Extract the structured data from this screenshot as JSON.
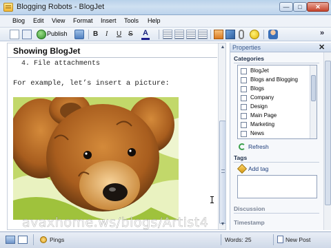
{
  "window": {
    "title": "Blogging Robots - BlogJet",
    "minimize": "—",
    "maximize": "□",
    "close": "✕"
  },
  "menu": [
    "Blog",
    "Edit",
    "View",
    "Format",
    "Insert",
    "Tools",
    "Help"
  ],
  "toolbar": {
    "publish_label": "Publish",
    "bold": "B",
    "italic": "I",
    "underline": "U",
    "strike": "S",
    "font_color": "A",
    "more": "»",
    "icons": [
      "new-post-icon",
      "open-blog-icon",
      "publish-icon",
      "spellcheck-icon",
      "font-color-icon",
      "numbered-list-icon",
      "bullet-list-icon",
      "outdent-icon",
      "indent-icon",
      "insert-image-icon",
      "insert-object-icon",
      "attach-file-icon",
      "smiley-icon",
      "user-icon"
    ]
  },
  "editor": {
    "post_title": "Showing BlogJet",
    "list_item": "4.  File attachments",
    "paragraph": "For example, let’s insert a picture:",
    "image_subject": "teddy bear lying on green and white fabric"
  },
  "properties": {
    "title": "Properties",
    "close": "✕",
    "categories_label": "Categories",
    "categories": [
      {
        "label": "BlogJet",
        "checked": false
      },
      {
        "label": "Blogs and Blogging",
        "checked": false
      },
      {
        "label": "Blogs",
        "checked": false
      },
      {
        "label": "Company",
        "checked": false
      },
      {
        "label": "Design",
        "checked": false
      },
      {
        "label": "Main Page",
        "checked": false
      },
      {
        "label": "Marketing",
        "checked": false
      },
      {
        "label": "News",
        "checked": false
      }
    ],
    "refresh_label": "Refresh",
    "tags_label": "Tags",
    "add_tag_label": "Add tag",
    "discussion_label": "Discussion",
    "timestamp_label": "Timestamp"
  },
  "status": {
    "pings_label": "Pings",
    "words": "Words: 25",
    "new_post": "New Post"
  },
  "watermark": "avaxhome.ws/blogs/Artist4"
}
